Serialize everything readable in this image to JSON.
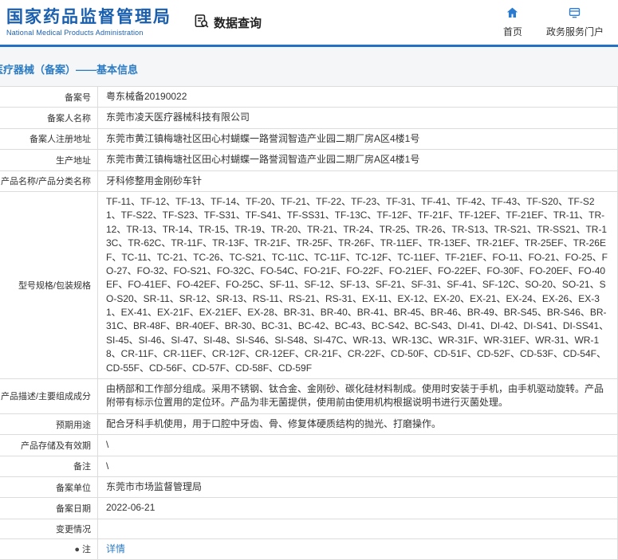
{
  "colors": {
    "brand_blue": "#1a5fae",
    "link_blue": "#2c7cc3",
    "divider_blue": "#2470c2",
    "icon_blue": "#2b7bd0"
  },
  "header": {
    "org_name_cn": "国家药品监督管理局",
    "org_name_en": "National Medical Products Administration",
    "nav_data_query": "数据查询",
    "nav_home": "首页",
    "nav_portal": "政务服务门户"
  },
  "page": {
    "title": "医疗器械（备案）——基本信息"
  },
  "table": {
    "rows": [
      {
        "label": "备案号",
        "value": "粤东械备20190022"
      },
      {
        "label": "备案人名称",
        "value": "东莞市凌天医疗器械科技有限公司"
      },
      {
        "label": "备案人注册地址",
        "value": "东莞市黄江镇梅塘社区田心村蝴蝶一路誉润智造产业园二期厂房A区4楼1号"
      },
      {
        "label": "生产地址",
        "value": "东莞市黄江镇梅塘社区田心村蝴蝶一路誉润智造产业园二期厂房A区4楼1号"
      },
      {
        "label": "产品名称/产品分类名称",
        "value": "牙科修整用金刚砂车针"
      },
      {
        "label": "型号规格/包装规格",
        "value": "TF-11、TF-12、TF-13、TF-14、TF-20、TF-21、TF-22、TF-23、TF-31、TF-41、TF-42、TF-43、TF-S20、TF-S21、TF-S22、TF-S23、TF-S31、TF-S41、TF-SS31、TF-13C、TF-12F、TF-21F、TF-12EF、TF-21EF、TR-11、TR-12、TR-13、TR-14、TR-15、TR-19、TR-20、TR-21、TR-24、TR-25、TR-26、TR-S13、TR-S21、TR-SS21、TR-13C、TR-62C、TR-11F、TR-13F、TR-21F、TR-25F、TR-26F、TR-11EF、TR-13EF、TR-21EF、TR-25EF、TR-26EF、TC-11、TC-21、TC-26、TC-S21、TC-11C、TC-11F、TC-12F、TC-11EF、TF-21EF、FO-11、FO-21、FO-25、FO-27、FO-32、FO-S21、FO-32C、FO-54C、FO-21F、FO-22F、FO-21EF、FO-22EF、FO-30F、FO-20EF、FO-40EF、FO-41EF、FO-42EF、FO-25C、SF-11、SF-12、SF-13、SF-21、SF-31、SF-41、SF-12C、SO-20、SO-21、SO-S20、SR-11、SR-12、SR-13、RS-11、RS-21、RS-31、EX-11、EX-12、EX-20、EX-21、EX-24、EX-26、EX-31、EX-41、EX-21F、EX-21EF、EX-28、BR-31、BR-40、BR-41、BR-45、BR-46、BR-49、BR-S45、BR-S46、BR-31C、BR-48F、BR-40EF、BR-30、BC-31、BC-42、BC-43、BC-S42、BC-S43、DI-41、DI-42、DI-S41、DI-SS41、SI-45、SI-46、SI-47、SI-48、SI-S46、SI-S48、SI-47C、WR-13、WR-13C、WR-31F、WR-31EF、WR-31、WR-18、CR-11F、CR-11EF、CR-12F、CR-12EF、CR-21F、CR-22F、CD-50F、CD-51F、CD-52F、CD-53F、CD-54F、CD-55F、CD-56F、CD-57F、CD-58F、CD-59F"
      },
      {
        "label": "产品描述/主要组成成分",
        "value": "由柄部和工作部分组成。采用不锈钢、钛合金、金刚砂、碳化硅材料制成。使用时安装于手机，由手机驱动旋转。产品附带有标示位置用的定位环。产品为非无菌提供，使用前由使用机构根据说明书进行灭菌处理。"
      },
      {
        "label": "预期用途",
        "value": "配合牙科手机使用，用于口腔中牙齿、骨、修复体硬质结构的抛光、打磨操作。"
      },
      {
        "label": "产品存储及有效期",
        "value": "\\"
      },
      {
        "label": "备注",
        "value": "\\"
      },
      {
        "label": "备案单位",
        "value": "东莞市市场监督管理局"
      },
      {
        "label": "备案日期",
        "value": "2022-06-21"
      },
      {
        "label": "变更情况",
        "value": ""
      },
      {
        "label": "注",
        "icon": "●",
        "value": "详情",
        "link": true
      }
    ]
  }
}
